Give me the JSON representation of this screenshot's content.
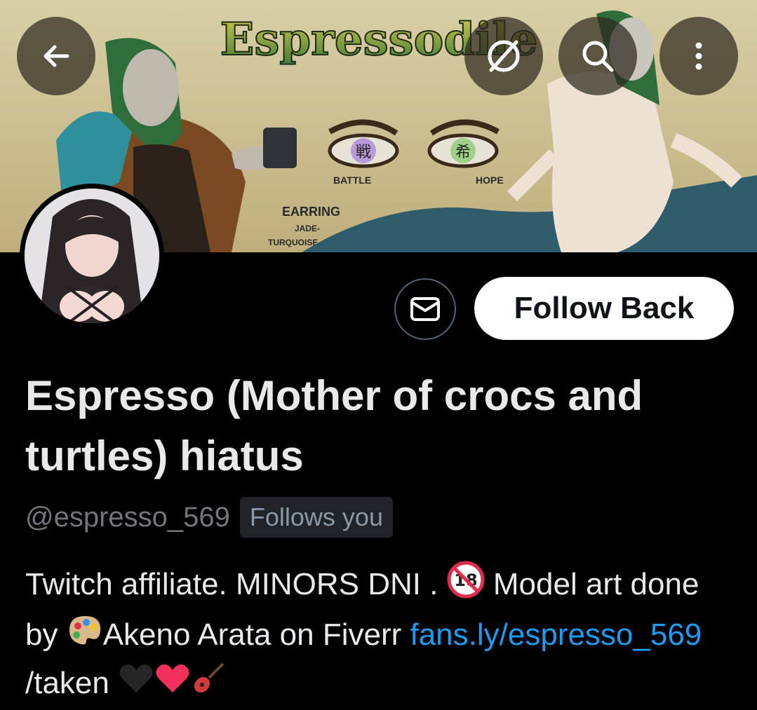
{
  "header": {
    "back_icon": "back-arrow-icon",
    "hidden_icon": "no-signal-icon",
    "search_icon": "search-icon",
    "more_icon": "more-vertical-icon"
  },
  "banner": {
    "title": "Espressodile",
    "left_eye_label": "BATTLE",
    "left_eye_glyph": "戦",
    "right_eye_label": "HOPE",
    "right_eye_glyph": "希",
    "earring_label": "EARRING",
    "earring_line1": "JADE-",
    "earring_line2": "TURQUOISE-"
  },
  "profile": {
    "display_name": "Espresso (Mother of crocs and turtles) hiatus",
    "handle": "@espresso_569",
    "follows_you": "Follows you",
    "follow_label": "Follow Back",
    "message_icon": "envelope-icon"
  },
  "bio": {
    "part1": "Twitch affiliate. MINORS DNI . ",
    "no18_icon": "no-under-18-icon",
    "part2": " Model art done by ",
    "palette_icon": "artist-palette-icon",
    "part3": "Akeno Arata on Fiverr ",
    "link": "fans.ly/espresso_569",
    "part4": " /taken ",
    "emoji_icons": [
      "black-heart-icon",
      "red-heart-icon",
      "guitar-icon"
    ]
  },
  "colors": {
    "background": "#000000",
    "text": "#e7e9ea",
    "secondary": "#71767b",
    "link": "#1d9bf0",
    "follow_bg": "#ffffff"
  }
}
